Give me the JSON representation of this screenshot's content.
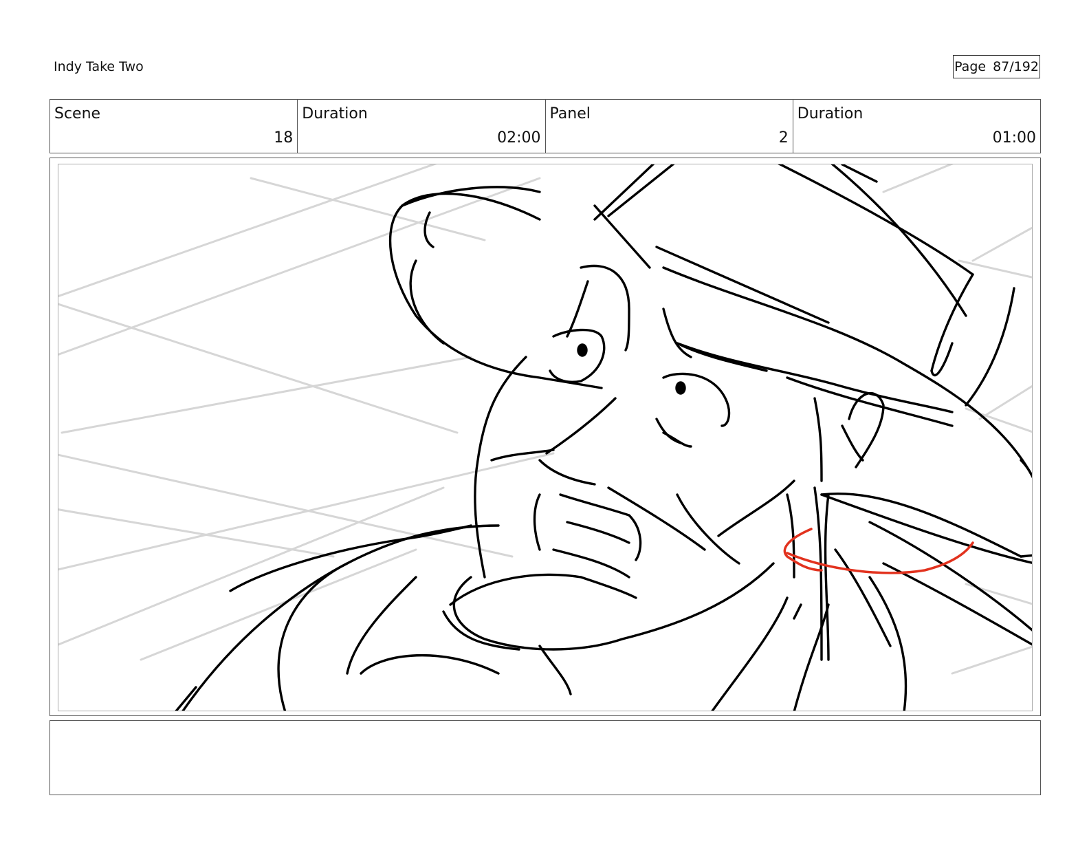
{
  "header": {
    "title": "Indy Take Two",
    "page_label": "Page",
    "page_number": "87/192"
  },
  "info": {
    "scene_label": "Scene",
    "scene_value": "18",
    "scene_duration_label": "Duration",
    "scene_duration_value": "02:00",
    "panel_label": "Panel",
    "panel_value": "2",
    "panel_duration_label": "Duration",
    "panel_duration_value": "01:00"
  },
  "notes": {
    "text": ""
  },
  "colors": {
    "sketch_line": "#000000",
    "guide_line": "#d6d6d6",
    "annotation": "#e2321e"
  },
  "panel_image": {
    "icon": "storyboard-sketch-icon"
  }
}
